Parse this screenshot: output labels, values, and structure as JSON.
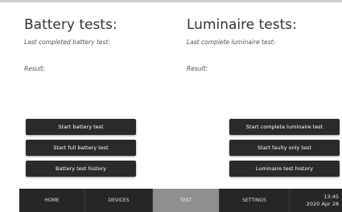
{
  "battery": {
    "title": "Battery tests:",
    "last_label": "Last completed battery test:",
    "result_label": "Result:",
    "buttons": [
      "Start battery test",
      "Start full battery test",
      "Battery test history"
    ]
  },
  "luminaire": {
    "title": "Luminaire tests:",
    "last_label": "Last complete luminaire test:",
    "result_label": "Result:",
    "buttons": [
      "Start complete luminaire test",
      "Start faulty only test",
      "Luminaire test history"
    ]
  },
  "nav": {
    "items": [
      "HOME",
      "DEVICES",
      "TEST",
      "SETTINGS"
    ],
    "active": "TEST",
    "time": "13:45",
    "date": "2020 Apr 28"
  }
}
